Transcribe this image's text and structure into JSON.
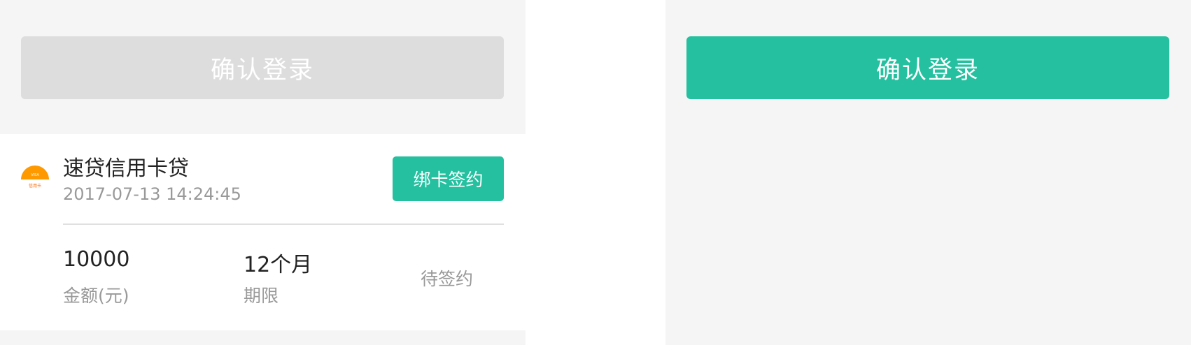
{
  "left": {
    "confirm_button_label": "确认登录",
    "loan": {
      "logo_text": "VISA",
      "logo_caption": "信用卡",
      "title": "速贷信用卡贷",
      "timestamp": "2017-07-13  14:24:45",
      "bind_button_label": "绑卡签约",
      "amount_value": "10000",
      "amount_label": "金额(元)",
      "term_value": "12个月",
      "term_label": "期限",
      "status": "待签约"
    }
  },
  "right": {
    "confirm_button_label": "确认登录"
  },
  "colors": {
    "accent": "#24c09f",
    "disabled": "#dddddd",
    "logo_orange": "#ff9900",
    "background": "#f5f5f5"
  }
}
